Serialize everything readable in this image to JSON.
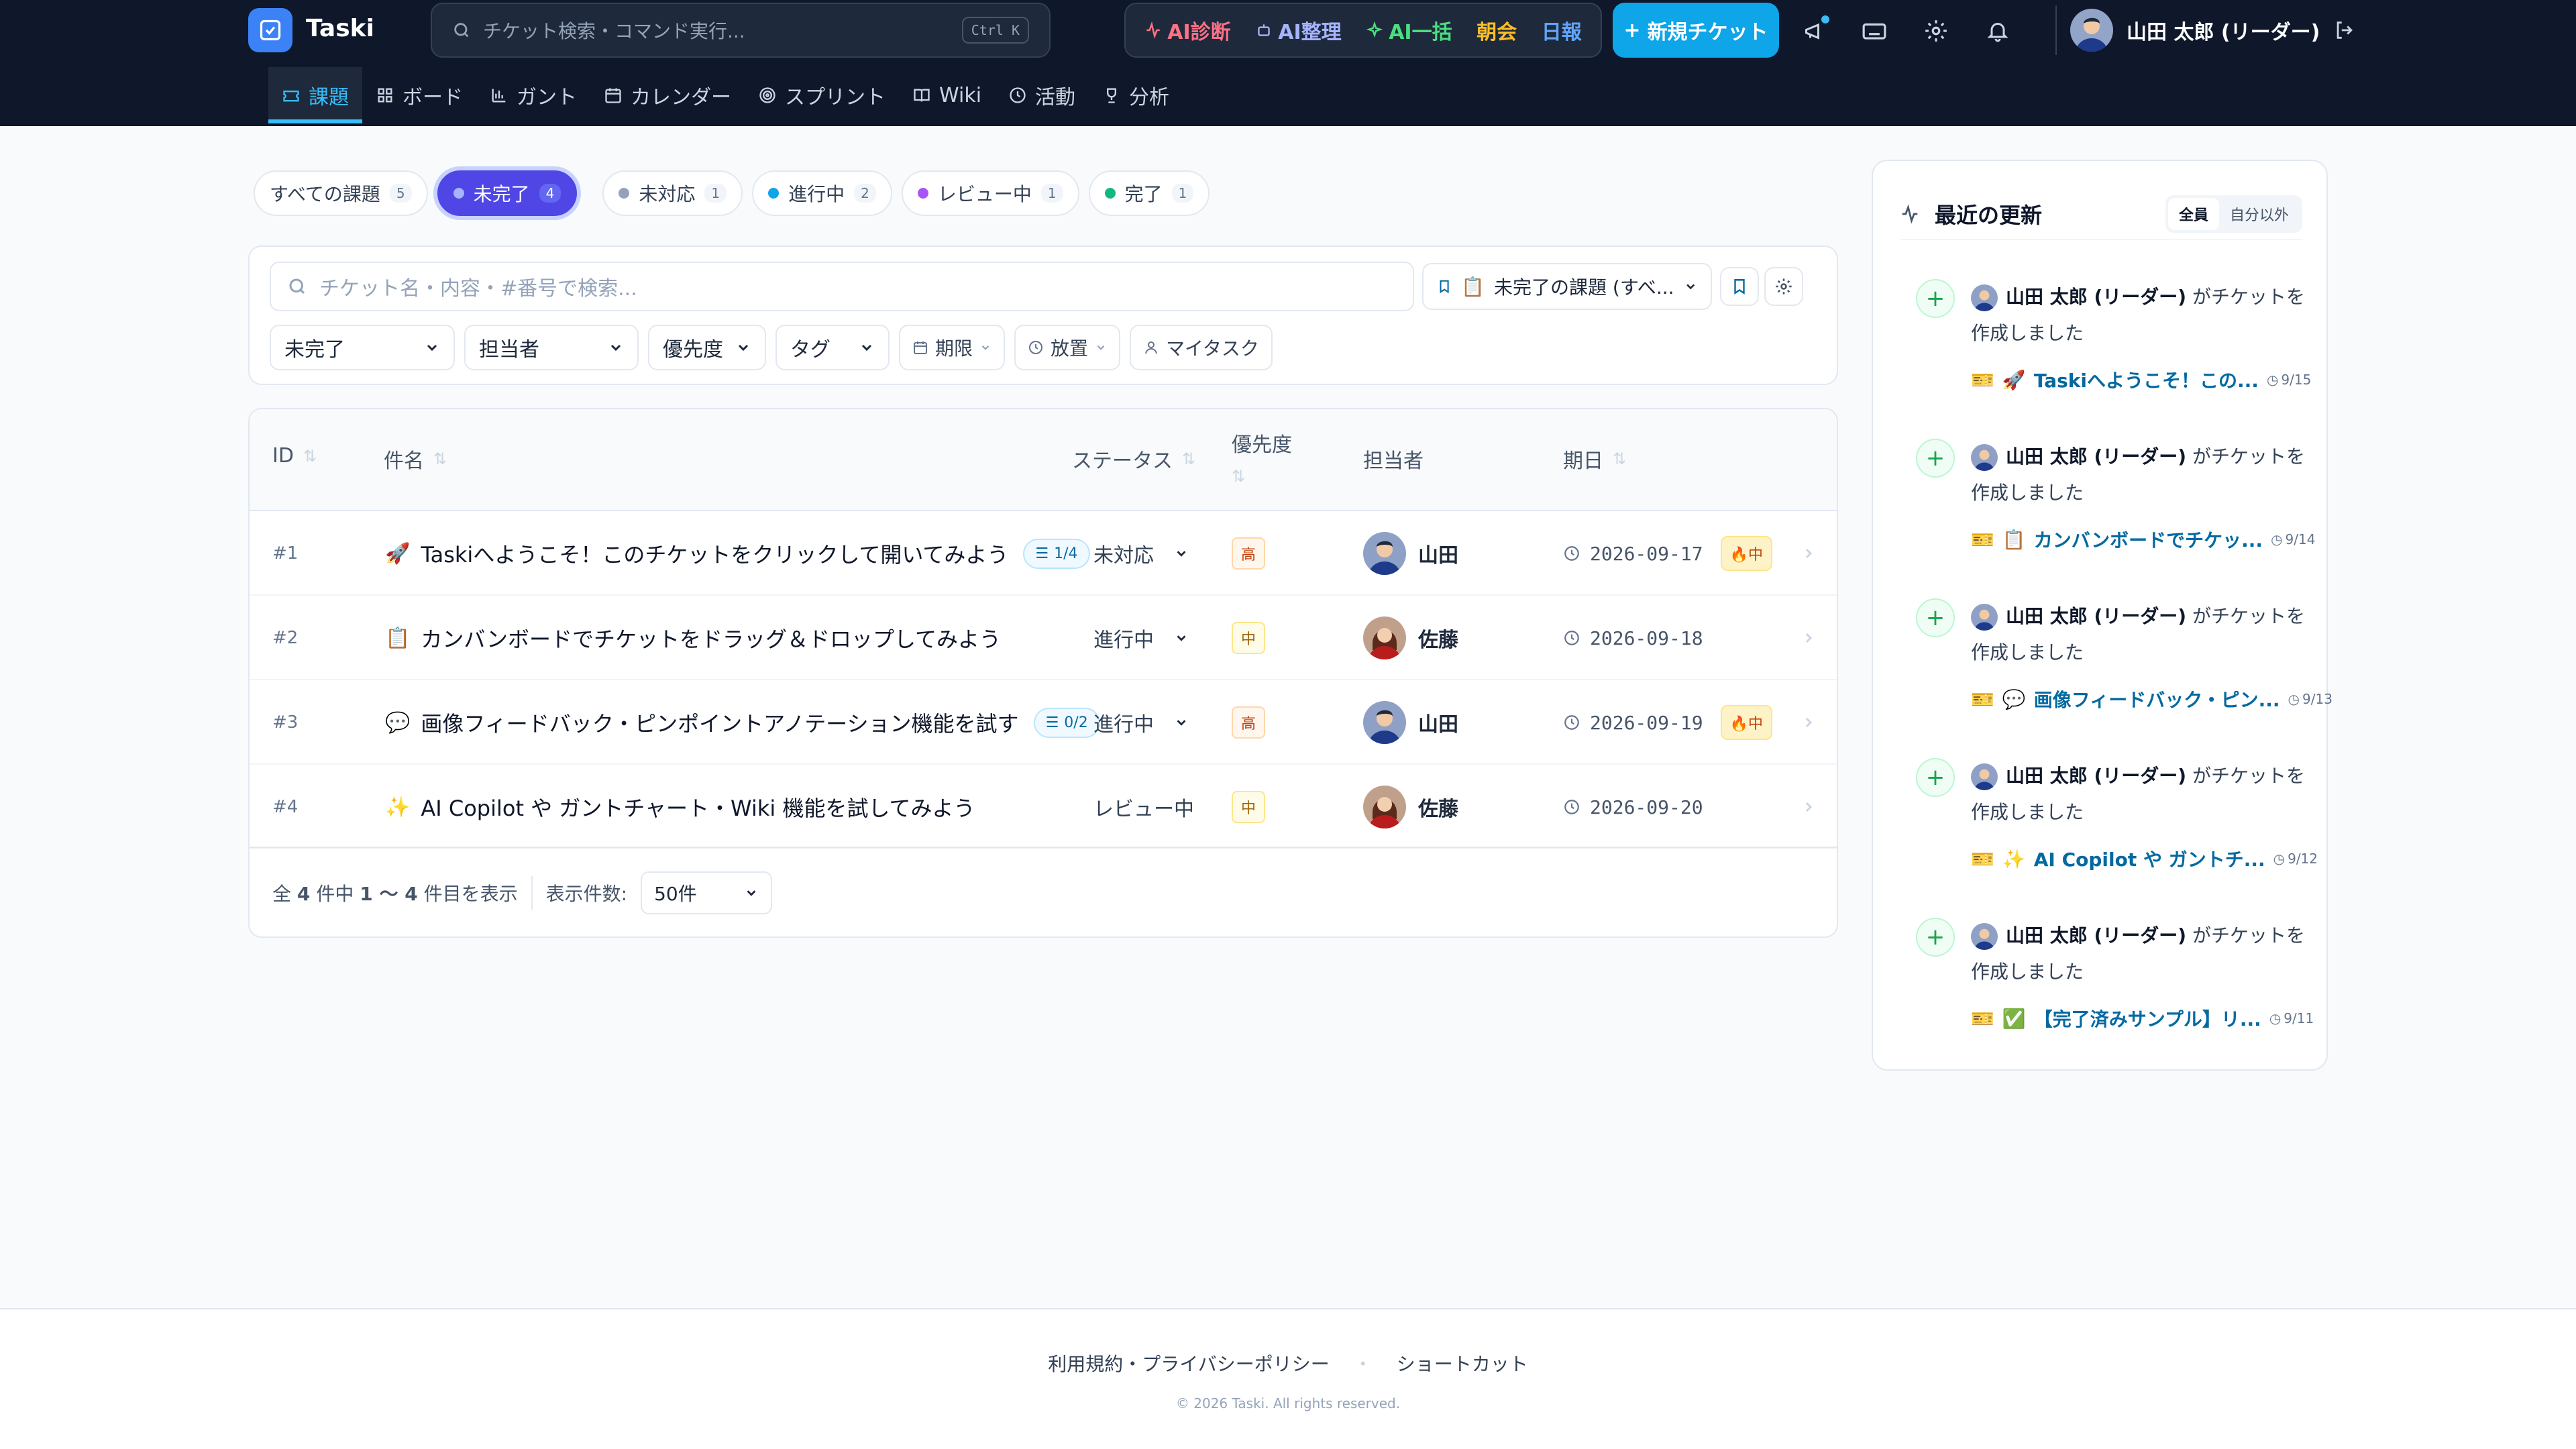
{
  "app": {
    "name": "Taski"
  },
  "search": {
    "placeholder": "チケット検索・コマンド実行...",
    "shortcut": "Ctrl K"
  },
  "ai_bar": {
    "diagnose": "AI診断",
    "organize": "AI整理",
    "bulk": "AI一括",
    "morning": "朝会",
    "daily": "日報"
  },
  "new_ticket": "新規チケット",
  "user": {
    "name": "山田 太郎 (リーダー)"
  },
  "nav": {
    "tabs": [
      "課題",
      "ボード",
      "ガント",
      "カレンダー",
      "スプリント",
      "Wiki",
      "活動",
      "分析"
    ],
    "active": "課題"
  },
  "status_pills": [
    {
      "label": "すべての課題",
      "count": "5"
    },
    {
      "label": "未完了",
      "count": "4",
      "active": true
    },
    {
      "label": "未対応",
      "count": "1",
      "color": "#94a3b8"
    },
    {
      "label": "進行中",
      "count": "2",
      "color": "#0ea5e9"
    },
    {
      "label": "レビュー中",
      "count": "1",
      "color": "#a855f7"
    },
    {
      "label": "完了",
      "count": "1",
      "color": "#10b981"
    }
  ],
  "filters": {
    "search_placeholder": "チケット名・内容・#番号で検索...",
    "saved_view": "未完了の課題 (すべ...",
    "status": "未完了",
    "assignee": "担当者",
    "priority": "優先度",
    "tag": "タグ",
    "due": "期限",
    "stale": "放置",
    "my_tasks": "マイタスク"
  },
  "table": {
    "headers": {
      "id": "ID",
      "title": "件名",
      "status": "ステータス",
      "priority": "優先度",
      "assignee": "担当者",
      "due": "期日"
    },
    "rows": [
      {
        "id": "#1",
        "emoji": "🚀",
        "title": "Taskiへようこそ！このチケットをクリックして開いてみよう",
        "checklist": "1/4",
        "status": "未対応",
        "priority": "高",
        "assignee": "山田",
        "due": "2026-09-17",
        "hot": "中"
      },
      {
        "id": "#2",
        "emoji": "📋",
        "title": "カンバンボードでチケットをドラッグ＆ドロップしてみよう",
        "checklist": "",
        "status": "進行中",
        "priority": "中",
        "assignee": "佐藤",
        "due": "2026-09-18",
        "hot": ""
      },
      {
        "id": "#3",
        "emoji": "💬",
        "title": "画像フィードバック・ピンポイントアノテーション機能を試す",
        "checklist": "0/2",
        "status": "進行中",
        "priority": "高",
        "assignee": "山田",
        "due": "2026-09-19",
        "hot": "中"
      },
      {
        "id": "#4",
        "emoji": "✨",
        "title": "AI Copilot や ガントチャート・Wiki 機能を試してみよう",
        "checklist": "",
        "status": "レビュー中",
        "priority": "中",
        "assignee": "佐藤",
        "due": "2026-09-20",
        "hot": ""
      }
    ],
    "footer": {
      "summary_pre": "全",
      "total": "4",
      "summary_mid": "件中",
      "range": "1 〜 4",
      "summary_post": "件目を表示",
      "per_page_label": "表示件数:",
      "per_page": "50件"
    }
  },
  "activity": {
    "title": "最近の更新",
    "seg": [
      "全員",
      "自分以外"
    ],
    "items": [
      {
        "user": "山田 太郎 (リーダー)",
        "action": "がチケットを作成しました",
        "emoji": "🚀",
        "ticket": "Taskiへようこそ！この...",
        "date": "9/15"
      },
      {
        "user": "山田 太郎 (リーダー)",
        "action": "がチケットを作成しました",
        "emoji": "📋",
        "ticket": "カンバンボードでチケッ...",
        "date": "9/14"
      },
      {
        "user": "山田 太郎 (リーダー)",
        "action": "がチケットを作成しました",
        "emoji": "💬",
        "ticket": "画像フィードバック・ピン...",
        "date": "9/13"
      },
      {
        "user": "山田 太郎 (リーダー)",
        "action": "がチケットを作成しました",
        "emoji": "✨",
        "ticket": "AI Copilot や ガントチ...",
        "date": "9/12"
      },
      {
        "user": "山田 太郎 (リーダー)",
        "action": "がチケットを作成しました",
        "emoji": "✅",
        "ticket": "【完了済みサンプル】リ...",
        "date": "9/11"
      }
    ]
  },
  "page_footer": {
    "terms": "利用規約・プライバシーポリシー",
    "sep": "・",
    "shortcuts": "ショートカット",
    "copyright": "© 2026 Taski. All rights reserved."
  }
}
